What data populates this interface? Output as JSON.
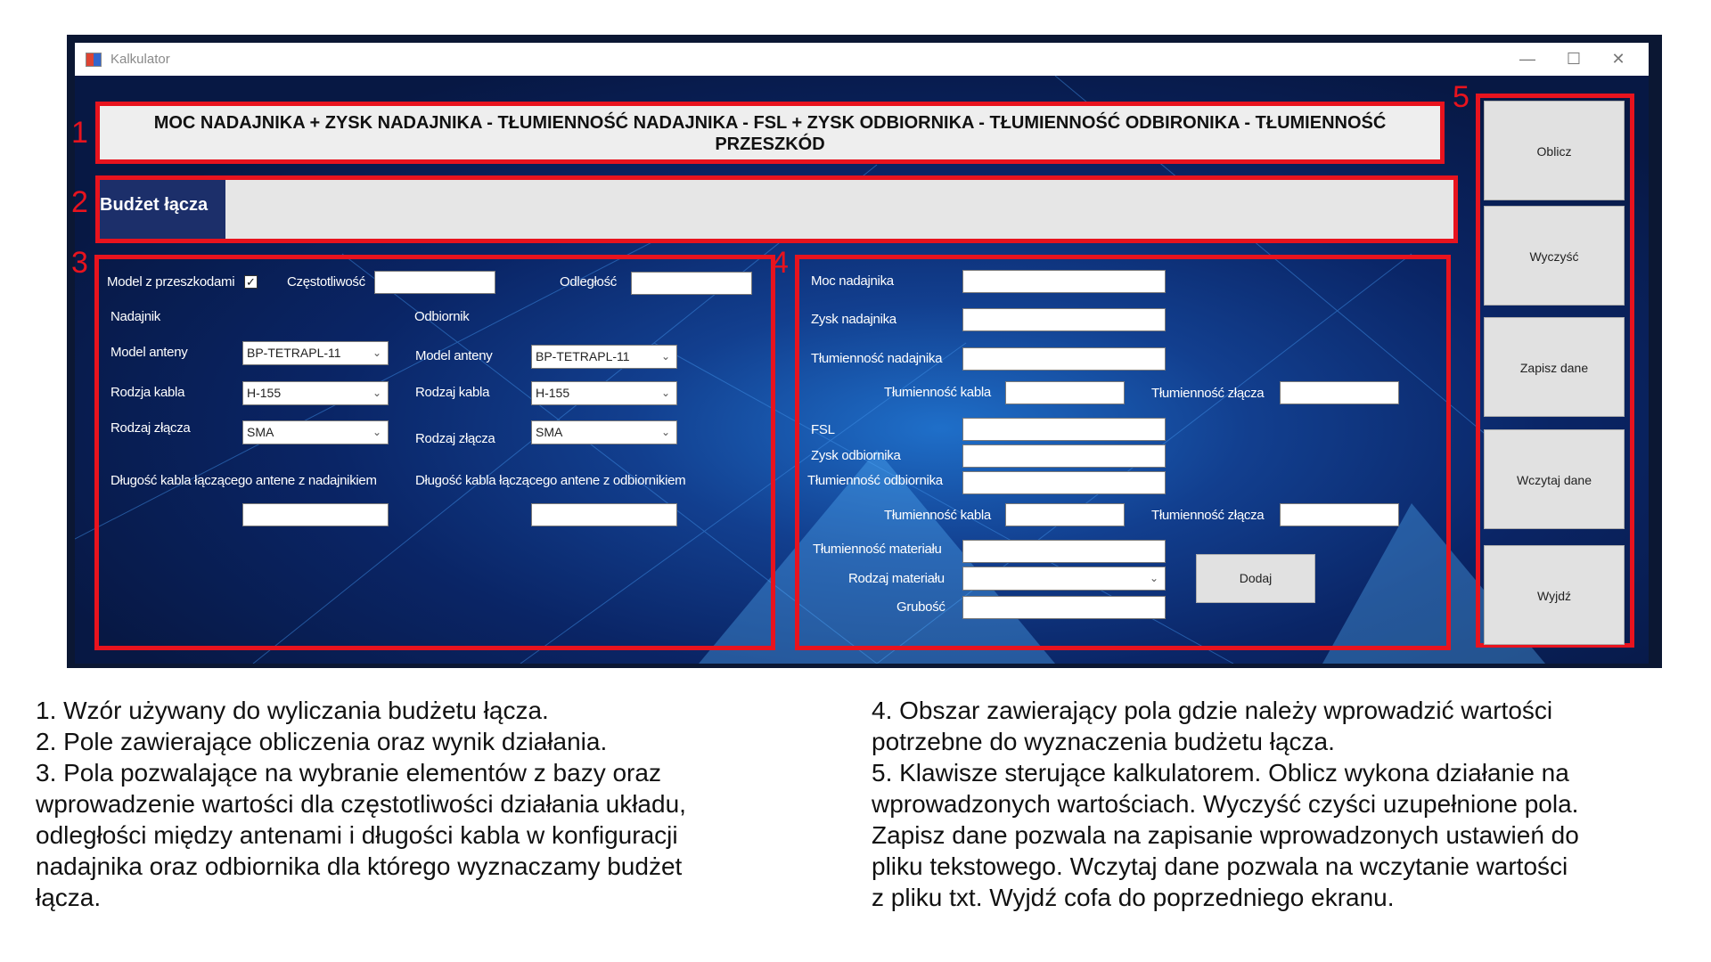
{
  "window": {
    "title": "Kalkulator",
    "controls": {
      "minimize": "—",
      "maximize": "☐",
      "close": "✕"
    }
  },
  "formula": {
    "line1": "MOC NADAJNIKA + ZYSK NADAJNIKA - TŁUMIENNOŚĆ NADAJNIKA - FSL + ZYSK ODBIORNIKA - TŁUMIENNOŚĆ ODBIRONIKA - TŁUMIENNOŚĆ",
    "line2": "PRZESZKÓD"
  },
  "budget": {
    "label": "Budżet łącza",
    "result": ""
  },
  "markers": [
    "1",
    "2",
    "3",
    "4",
    "5"
  ],
  "panel3": {
    "model_z_przeszkodami_label": "Model z przeszkodami",
    "model_z_przeszkodami_checked": true,
    "czestotliwosc_label": "Częstotliwość",
    "odleglosc_label": "Odległość",
    "nadajnik_label": "Nadajnik",
    "odbiornik_label": "Odbiornik",
    "tx": {
      "model_anteny_label": "Model anteny",
      "model_anteny_value": "BP-TETRAPL-11",
      "rodzaj_kabla_label": "Rodzja kabla",
      "rodzaj_kabla_value": "H-155",
      "rodzaj_zlacza_label": "Rodzaj złącza",
      "rodzaj_zlacza_value": "SMA",
      "dlugosc_label": "Długość kabla łączącego antene z nadajnikiem"
    },
    "rx": {
      "model_anteny_label": "Model anteny",
      "model_anteny_value": "BP-TETRAPL-11",
      "rodzaj_kabla_label": "Rodzaj kabla",
      "rodzaj_kabla_value": "H-155",
      "rodzaj_zlacza_label": "Rodzaj złącza",
      "rodzaj_zlacza_value": "SMA",
      "dlugosc_label": "Długość kabla łączącego antene z odbiornikiem"
    }
  },
  "panel4": {
    "moc_nadajnika": "Moc nadajnika",
    "zysk_nadajnika": "Zysk nadajnika",
    "tlumiennosc_nadajnika": "Tłumienność nadajnika",
    "tlumiennosc_kabla_1": "Tłumienność kabla",
    "tlumiennosc_zlacza_1": "Tłumienność złącza",
    "fsl": "FSL",
    "zysk_odbiornika": "Zysk odbiornika",
    "tlumiennosc_odbiornika": "Tłumienność odbiornika",
    "tlumiennosc_kabla_2": "Tłumienność kabla",
    "tlumiennosc_zlacza_2": "Tłumienność złącza",
    "tlumiennosc_materialu": "Tłumienność materiału",
    "rodzaj_materialu": "Rodzaj materiału",
    "rodzaj_materialu_value": "",
    "grubosc": "Grubość",
    "dodaj": "Dodaj"
  },
  "buttons": {
    "oblicz": "Oblicz",
    "wyczysc": "Wyczyść",
    "zapisz": "Zapisz dane",
    "wczytaj": "Wczytaj dane",
    "wyjdz": "Wyjdź"
  },
  "captions": {
    "left": [
      "1. Wzór używany do wyliczania budżetu łącza.",
      "2. Pole zawierające obliczenia oraz wynik działania.",
      "3. Pola pozwalające na wybranie elementów z bazy oraz",
      "wprowadzenie wartości dla częstotliwości działania układu,",
      "odległości między antenami i długości kabla w konfiguracji",
      "nadajnika oraz odbiornika dla którego wyznaczamy budżet",
      "łącza."
    ],
    "right": [
      "4. Obszar zawierający pola gdzie należy wprowadzić wartości",
      "potrzebne do wyznaczenia budżetu łącza.",
      "5. Klawisze sterujące kalkulatorem. Oblicz wykona działanie na",
      "wprowadzonych wartościach. Wyczyść czyści uzupełnione pola.",
      "Zapisz dane pozwala na zapisanie wprowadzonych ustawień do",
      "pliku tekstowego. Wczytaj dane pozwala na wczytanie wartości",
      "z pliku txt. Wyjdź cofa do poprzedniego ekranu."
    ]
  },
  "colors": {
    "annotation_red": "#e8131e",
    "background_blue": "#0a2566"
  },
  "icons": [
    "app-icon",
    "checkbox-check-icon",
    "dropdown-arrow-icon"
  ]
}
